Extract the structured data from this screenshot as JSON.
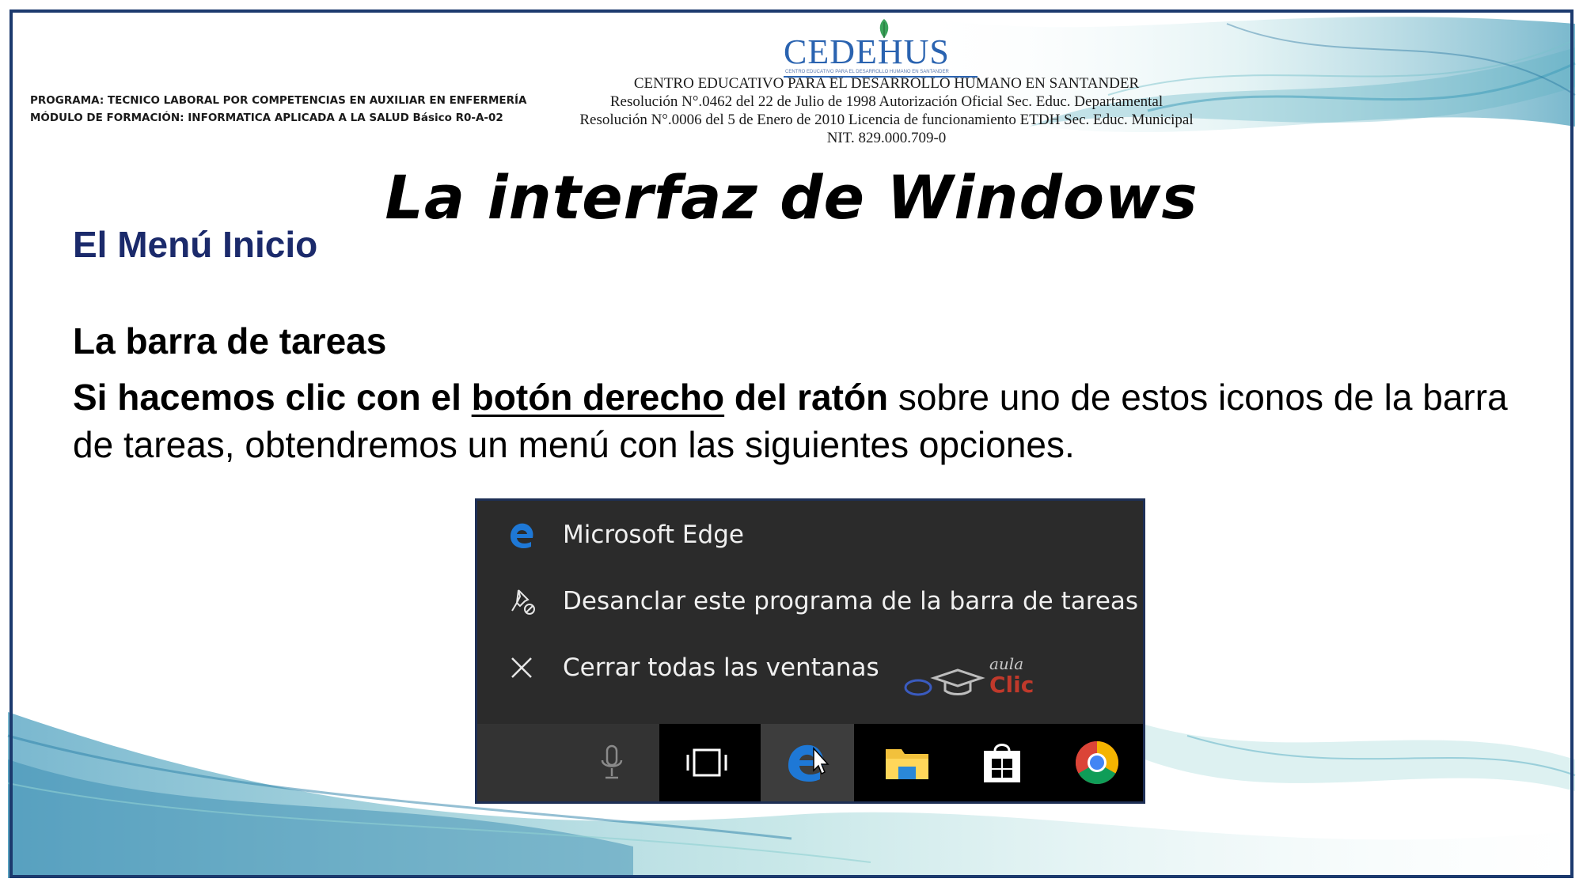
{
  "header": {
    "program_line": "PROGRAMA: TECNICO LABORAL POR COMPETENCIAS EN AUXILIAR EN ENFERMERÍA",
    "module_line": "MÓDULO DE FORMACIÓN: INFORMATICA APLICADA A LA SALUD Básico R0-A-02",
    "logo_text": "CEDEHUS",
    "logo_tagline": "CENTRO EDUCATIVO PARA EL DESARROLLO HUMANO EN SANTANDER",
    "institution_name": "CENTRO EDUCATIVO PARA EL DESARROLLO HUMANO EN SANTANDER",
    "resolution_1": "Resolución  N°.0462 del 22 de Julio de 1998  Autorización Oficial Sec. Educ. Departamental",
    "resolution_2": "Resolución N°.0006 del 5 de Enero de 2010 Licencia de funcionamiento ETDH Sec. Educ. Municipal",
    "nit": "NIT. 829.000.709-0"
  },
  "slide": {
    "title": "La interfaz de Windows",
    "subtitle": "El Menú Inicio",
    "section_heading": "La barra de tareas",
    "body_bold_1": "Si hacemos clic con el ",
    "body_underlined": "botón derecho",
    "body_bold_2": " del ratón",
    "body_rest": " sobre uno de estos iconos de la barra de tareas, obtendremos un menú con las siguientes opciones."
  },
  "context_menu": {
    "items": [
      {
        "label": "Microsoft Edge",
        "icon": "edge-icon"
      },
      {
        "label": "Desanclar este programa de la barra de tareas",
        "icon": "unpin-icon"
      },
      {
        "label": "Cerrar todas las ventanas",
        "icon": "close-icon"
      }
    ]
  },
  "watermark": {
    "line1": "aula",
    "line2": "Clic"
  },
  "taskbar": {
    "buttons": [
      "microphone-icon",
      "task-view-icon",
      "edge-icon",
      "file-explorer-icon",
      "store-icon",
      "chrome-icon"
    ]
  },
  "colors": {
    "frame": "#1c3a6e",
    "subtitle": "#1b2a6b",
    "logo": "#2a63b0",
    "menu_bg": "#2b2b2b",
    "taskbar_bg": "#000000",
    "edge_blue": "#1e78d6"
  }
}
